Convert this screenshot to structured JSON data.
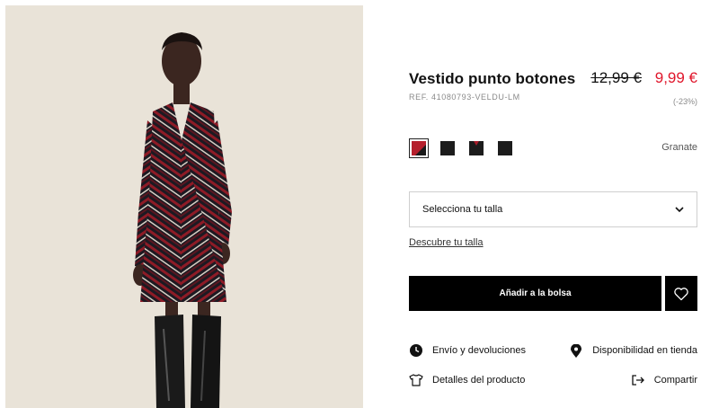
{
  "product": {
    "title": "Vestido punto botones",
    "reference": "REF. 41080793-VELDU-LM",
    "price_old": "12,99 €",
    "price_new": "9,99 €",
    "discount": "(-23%)",
    "color_name": "Granate",
    "swatches": [
      {
        "name": "granate",
        "selected": true,
        "colors": [
          "#b51f2c",
          "#1a1a1a"
        ]
      },
      {
        "name": "negro",
        "selected": false,
        "colors": [
          "#1c1c1c"
        ]
      },
      {
        "name": "negro-rojo",
        "selected": false,
        "colors": [
          "#1c1c1c",
          "#a81c2a"
        ]
      },
      {
        "name": "negro-liso",
        "selected": false,
        "colors": [
          "#1c1c1c"
        ]
      }
    ]
  },
  "size": {
    "select_label": "Selecciona tu talla",
    "guide_link": "Descubre tu talla"
  },
  "actions": {
    "add_to_bag": "Añadir a la bolsa"
  },
  "links": {
    "envio": "Envío y devoluciones",
    "disponibilidad": "Disponibilidad en tienda",
    "detalles": "Detalles del producto",
    "compartir": "Compartir"
  },
  "colors": {
    "sale_red": "#e0162b",
    "button_black": "#000000",
    "photo_bg": "#e9e3d8"
  }
}
